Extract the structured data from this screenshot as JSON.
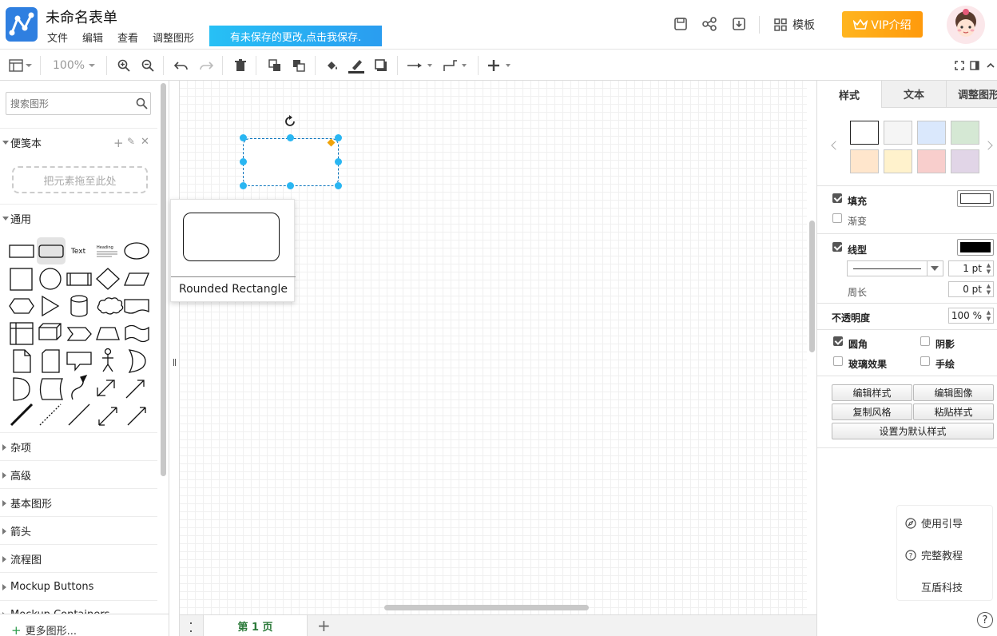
{
  "app": {
    "title": "未命名表单",
    "unsaved_notice": "有未保存的更改,点击我保存.",
    "menu": [
      "文件",
      "编辑",
      "查看",
      "调整图形"
    ],
    "template_label": "模板",
    "vip_label": "VIP介绍"
  },
  "toolbar": {
    "zoom": "100%"
  },
  "sidebar": {
    "search_placeholder": "搜索图形",
    "scratchpad": {
      "title": "便笺本",
      "drop_hint": "把元素拖至此处"
    },
    "general": {
      "title": "通用",
      "text_shape": "Text",
      "heading_shape": "Heading"
    },
    "sections": [
      "杂项",
      "高级",
      "基本图形",
      "箭头",
      "流程图",
      "Mockup Buttons",
      "Mockup Containers"
    ],
    "more_shapes": "更多图形..."
  },
  "tooltip": {
    "label": "Rounded Rectangle"
  },
  "pages": {
    "current": "第 1 页"
  },
  "panel": {
    "tabs": [
      "样式",
      "文本",
      "调整图形"
    ],
    "swatches": [
      "#ffffff",
      "#f5f5f5",
      "#dae8fc",
      "#d5e8d4",
      "#ffe6cc",
      "#fff2cc",
      "#f8cecc",
      "#e1d5e7"
    ],
    "fill_label": "填充",
    "fill_checked": true,
    "fill_color": "#ffffff",
    "gradient_label": "渐变",
    "gradient_checked": false,
    "line_label": "线型",
    "line_checked": true,
    "line_color": "#000000",
    "line_width": "1 pt",
    "perimeter_label": "周长",
    "perimeter": "0 pt",
    "opacity_label": "不透明度",
    "opacity": "100 %",
    "rounded_label": "圆角",
    "rounded_checked": true,
    "shadow_label": "阴影",
    "shadow_checked": false,
    "glass_label": "玻璃效果",
    "glass_checked": false,
    "sketch_label": "手绘",
    "sketch_checked": false,
    "buttons": {
      "edit_style": "编辑样式",
      "edit_image": "编辑图像",
      "copy_style": "复制风格",
      "paste_style": "粘贴样式",
      "set_default": "设置为默认样式"
    }
  },
  "help": {
    "guide": "使用引导",
    "tutorial": "完整教程",
    "company": "互盾科技"
  }
}
